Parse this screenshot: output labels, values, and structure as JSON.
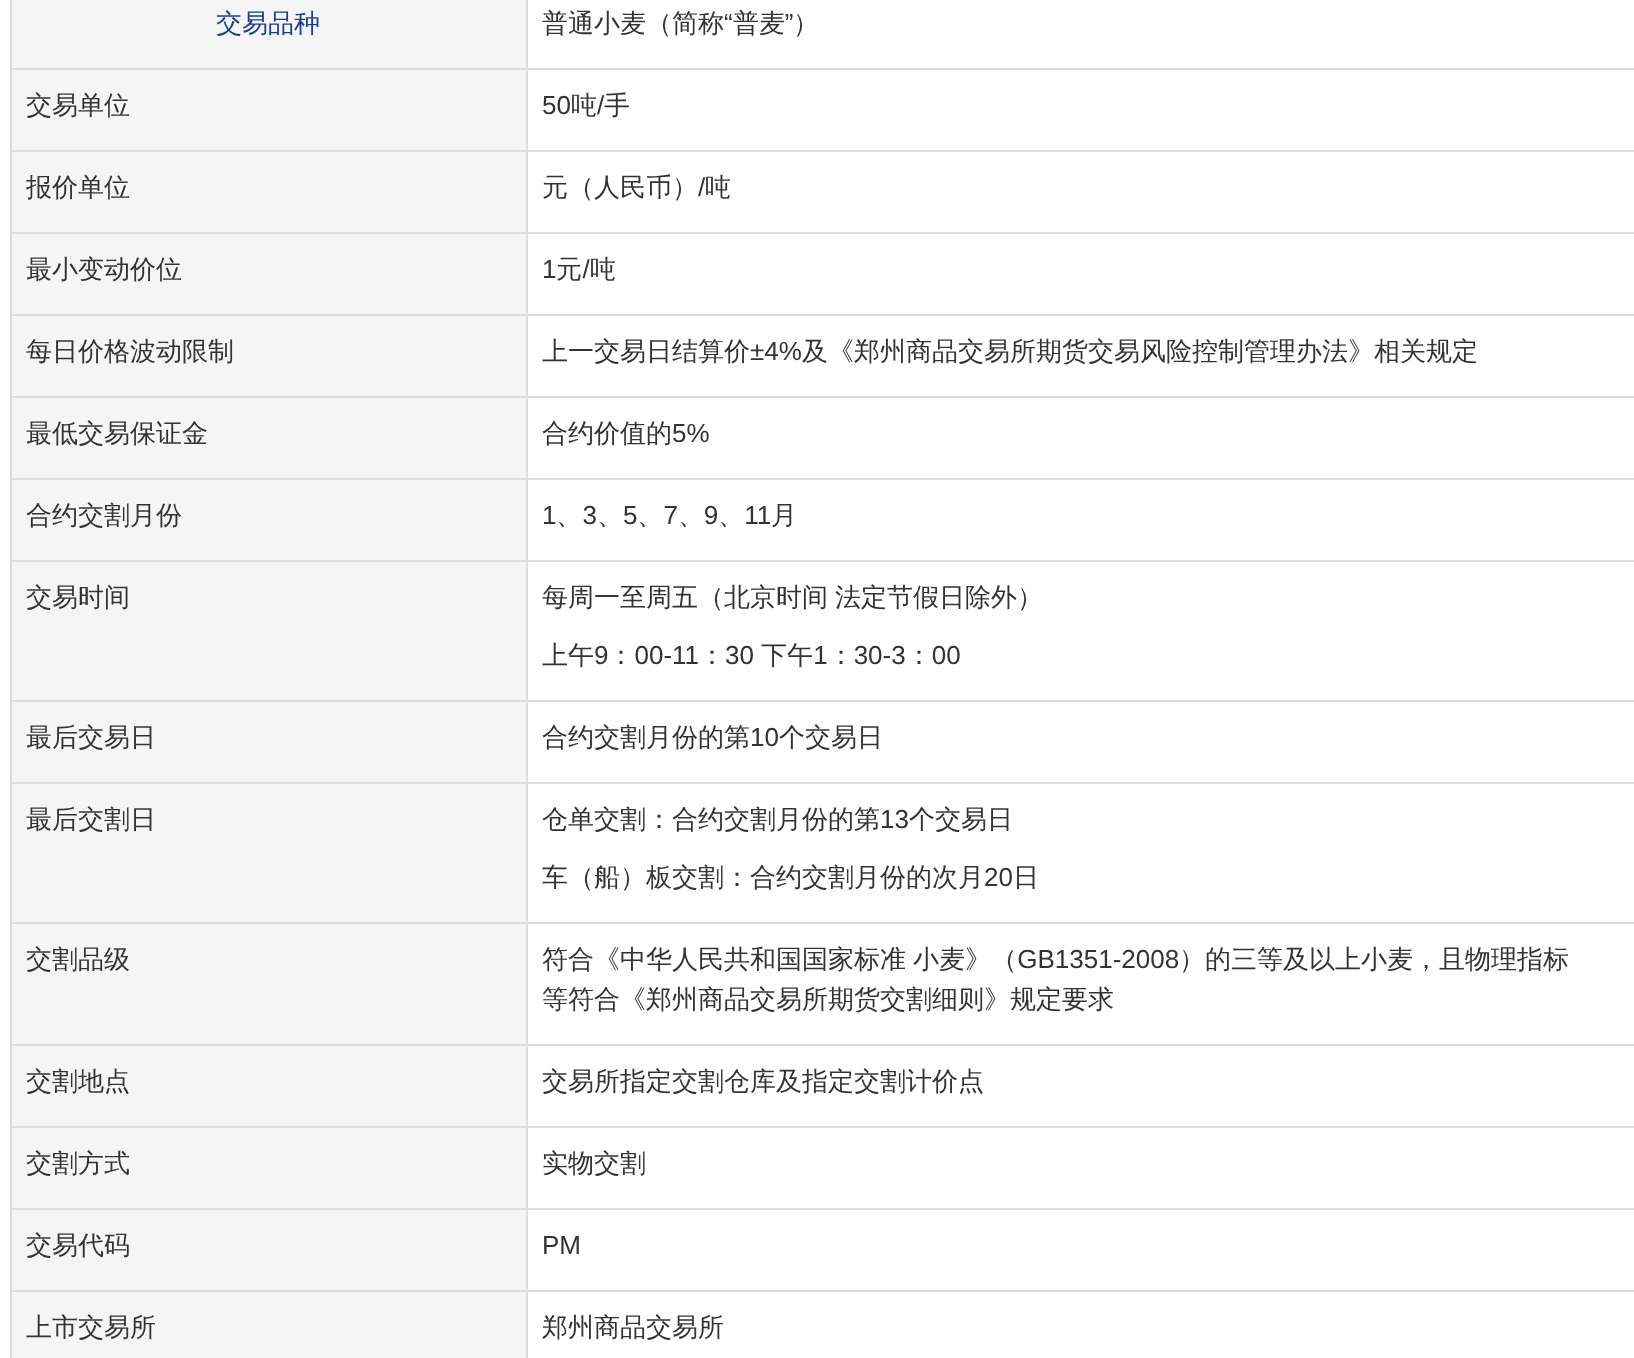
{
  "table": {
    "header": {
      "label": "交易品种",
      "values": [
        "普通小麦（简称“普麦”）"
      ]
    },
    "rows": [
      {
        "label": "交易单位",
        "values": [
          "50吨/手"
        ]
      },
      {
        "label": "报价单位",
        "values": [
          "元（人民币）/吨"
        ]
      },
      {
        "label": "最小变动价位",
        "values": [
          "1元/吨"
        ]
      },
      {
        "label": "每日价格波动限制",
        "values": [
          "上一交易日结算价±4%及《郑州商品交易所期货交易风险控制管理办法》相关规定"
        ]
      },
      {
        "label": "最低交易保证金",
        "values": [
          "合约价值的5%"
        ]
      },
      {
        "label": "合约交割月份",
        "values": [
          "1、3、5、7、9、11月"
        ]
      },
      {
        "label": "交易时间",
        "values": [
          "每周一至周五（北京时间 法定节假日除外）",
          "上午9：00-11：30 下午1：30-3：00"
        ]
      },
      {
        "label": "最后交易日",
        "values": [
          "合约交割月份的第10个交易日"
        ]
      },
      {
        "label": "最后交割日",
        "values": [
          "仓单交割：合约交割月份的第13个交易日",
          "车（船）板交割：合约交割月份的次月20日"
        ]
      },
      {
        "label": "交割品级",
        "values": [
          "符合《中华人民共和国国家标准 小麦》（GB1351-2008）的三等及以上小麦，且物理指标等符合《郑州商品交易所期货交割细则》规定要求"
        ]
      },
      {
        "label": "交割地点",
        "values": [
          "交易所指定交割仓库及指定交割计价点"
        ]
      },
      {
        "label": "交割方式",
        "values": [
          "实物交割"
        ]
      },
      {
        "label": "交易代码",
        "values": [
          "PM"
        ]
      },
      {
        "label": "上市交易所",
        "values": [
          "郑州商品交易所"
        ]
      }
    ]
  }
}
